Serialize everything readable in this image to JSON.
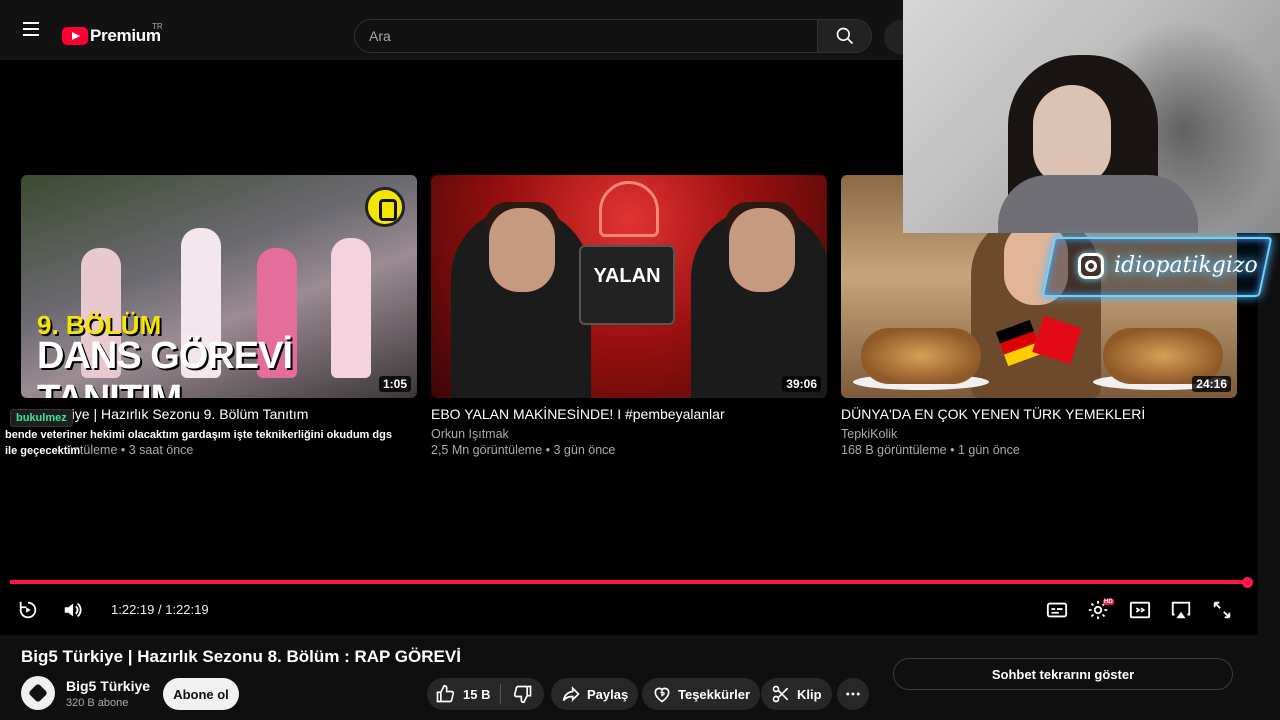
{
  "header": {
    "logo_text": "Premium",
    "country": "TR",
    "search_placeholder": "Ara"
  },
  "overlay": {
    "instagram_handle": "idiopatikgizo"
  },
  "end_cards": [
    {
      "title": "Big5 Türkiye | Hazırlık Sezonu 9. Bölüm Tanıtım",
      "visible_title": "rkiye | Hazırlık Sezonu 9. Bölüm Tanıtım",
      "channel": "",
      "meta": "3 saat önce",
      "duration": "1:05",
      "thumb_text_top": "9. BÖLÜM",
      "thumb_text_main": "DANS GÖREVİ TANITIM"
    },
    {
      "title": "EBO YALAN MAKİNESİNDE! I #pembeyalanlar",
      "channel": "Orkun Işıtmak",
      "meta": "2,5 Mn görüntüleme • 3 gün önce",
      "duration": "39:06",
      "thumb_text_main": "YALAN"
    },
    {
      "title": "DÜNYA'DA EN ÇOK YENEN TÜRK YEMEKLERİ",
      "channel": "TepkiKolik",
      "meta": "168 B görüntüleme • 1 gün önce",
      "duration": "24:16"
    }
  ],
  "chat": {
    "username": "bukulmez",
    "message": "bende veteriner hekimi olacaktım gardaşım işte teknikerliğini okudum dgs ile geçecektim",
    "partial_meta": "üntüleme • 3 saat önce"
  },
  "player": {
    "progress": 1.0,
    "time": "1:22:19 / 1:22:19",
    "colors": {
      "progress": "#ff1646"
    },
    "hd_badge": "HD"
  },
  "video": {
    "title": "Big5 Türkiye | Hazırlık Sezonu 8. Bölüm : RAP GÖREVİ",
    "channel_name": "Big5 Türkiye",
    "subscribers": "320 B abone",
    "subscribe_label": "Abone ol",
    "likes": "15 B",
    "share_label": "Paylaş",
    "thanks_label": "Teşekkürler",
    "clip_label": "Klip",
    "chat_replay_label": "Sohbet tekrarını göster"
  }
}
